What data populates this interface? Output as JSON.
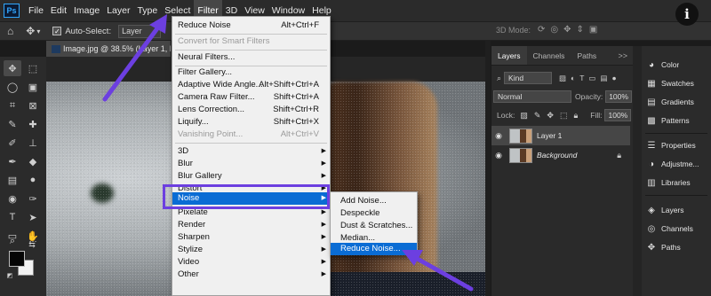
{
  "menubar": {
    "logo": "Ps",
    "items": [
      "File",
      "Edit",
      "Image",
      "Layer",
      "Type",
      "Select",
      "Filter",
      "3D",
      "View",
      "Window",
      "Help"
    ],
    "active_item": "Filter",
    "info_glyph": "i"
  },
  "options_bar": {
    "auto_select_label": "Auto-Select:",
    "auto_select_checked": true,
    "layer_select_value": "Layer",
    "mode_3d_label": "3D Mode:"
  },
  "document_tab": {
    "title": "Image.jpg @ 38.5% (Layer 1, R"
  },
  "filter_menu": {
    "items": [
      {
        "label": "Reduce Noise",
        "shortcut": "Alt+Ctrl+F",
        "enabled": true
      },
      {
        "label": "Convert for Smart Filters",
        "enabled": false
      },
      {
        "label": "Neural Filters...",
        "enabled": true
      },
      {
        "label": "Filter Gallery...",
        "enabled": true
      },
      {
        "label": "Adaptive Wide Angle...",
        "shortcut": "Alt+Shift+Ctrl+A",
        "enabled": true
      },
      {
        "label": "Camera Raw Filter...",
        "shortcut": "Shift+Ctrl+A",
        "enabled": true
      },
      {
        "label": "Lens Correction...",
        "shortcut": "Shift+Ctrl+R",
        "enabled": true
      },
      {
        "label": "Liquify...",
        "shortcut": "Shift+Ctrl+X",
        "enabled": true
      },
      {
        "label": "Vanishing Point...",
        "shortcut": "Alt+Ctrl+V",
        "enabled": false
      },
      {
        "label": "3D",
        "submenu": true
      },
      {
        "label": "Blur",
        "submenu": true
      },
      {
        "label": "Blur Gallery",
        "submenu": true
      },
      {
        "label": "Distort",
        "submenu": true
      },
      {
        "label": "Noise",
        "submenu": true,
        "highlighted": true
      },
      {
        "label": "Pixelate",
        "submenu": true
      },
      {
        "label": "Render",
        "submenu": true
      },
      {
        "label": "Sharpen",
        "submenu": true
      },
      {
        "label": "Stylize",
        "submenu": true
      },
      {
        "label": "Video",
        "submenu": true
      },
      {
        "label": "Other",
        "submenu": true
      }
    ]
  },
  "noise_submenu": {
    "items": [
      "Add Noise...",
      "Despeckle",
      "Dust & Scratches...",
      "Median...",
      "Reduce Noise..."
    ],
    "highlighted": "Reduce Noise..."
  },
  "layers_panel": {
    "tabs": [
      "Layers",
      "Channels",
      "Paths"
    ],
    "active_tab": "Layers",
    "more_glyph": ">>",
    "kind_filter": "Kind",
    "blend_mode": "Normal",
    "opacity_label": "Opacity:",
    "opacity_value": "100%",
    "lock_label": "Lock:",
    "fill_label": "Fill:",
    "fill_value": "100%",
    "layers": [
      {
        "name": "Layer 1",
        "selected": true,
        "visible": true
      },
      {
        "name": "Background",
        "selected": false,
        "visible": true,
        "locked": true
      }
    ]
  },
  "side_panel": {
    "items": [
      "Color",
      "Swatches",
      "Gradients",
      "Patterns",
      "Properties",
      "Adjustme...",
      "Libraries",
      "Layers",
      "Channels",
      "Paths"
    ]
  },
  "colors": {
    "accent_highlight": "#0a6cd4",
    "annotation_purple": "#6c3fe0",
    "menu_bg": "#f0f0f0",
    "ui_dark": "#2b2b2b"
  }
}
